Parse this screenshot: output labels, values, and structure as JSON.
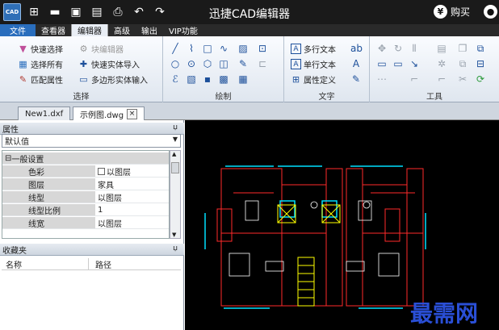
{
  "app": {
    "logo": "CAD",
    "title": "迅捷CAD编辑器",
    "buy_label": "购买",
    "buy_icon": "¥"
  },
  "quick_access": [
    "new-icon",
    "open-folder-icon",
    "save-icon",
    "save-as-icon",
    "print-icon",
    "undo-icon",
    "redo-icon"
  ],
  "menu": {
    "tabs": [
      "文件",
      "查看器",
      "编辑器",
      "高级",
      "输出",
      "VIP功能"
    ],
    "active": "编辑器"
  },
  "ribbon": {
    "select_group": {
      "label": "选择",
      "quick_select": "快速选择",
      "select_all": "选择所有",
      "match_properties": "匹配属性",
      "block_editor": "块编辑器",
      "quick_entity_import": "快速实体导入",
      "polygon_entity_import": "多边形实体输入"
    },
    "draw_group": {
      "label": "绘制"
    },
    "text_group": {
      "label": "文字",
      "multiline_text": "多行文本",
      "single_line_text": "单行文本",
      "attribute_definition": "属性定义"
    },
    "tools_group": {
      "label": "工具"
    }
  },
  "documents": {
    "tabs": [
      "New1.dxf",
      "示例图.dwg"
    ],
    "active": "示例图.dwg",
    "close_symbol": "×"
  },
  "properties_panel": {
    "title": "属性",
    "pin": "џ",
    "selector_value": "默认值",
    "group_toggle": "⊟",
    "group_name": "一般设置",
    "rows": [
      {
        "name": "色彩",
        "value": "以图层",
        "swatch": true
      },
      {
        "name": "图层",
        "value": "家具"
      },
      {
        "name": "线型",
        "value": "以图层"
      },
      {
        "name": "线型比例",
        "value": "1"
      },
      {
        "name": "线宽",
        "value": "以图层"
      }
    ]
  },
  "favorites_panel": {
    "title": "收藏夹",
    "pin": "џ",
    "col_name": "名称",
    "col_path": "路径"
  },
  "canvas": {
    "background": "#000000",
    "watermark": "最需网"
  },
  "colors": {
    "wall": "#ff2a2a",
    "window": "#00e0ff",
    "furniture": "#ffffff",
    "stair": "#ffff00",
    "accent": "#2a6ebd"
  }
}
